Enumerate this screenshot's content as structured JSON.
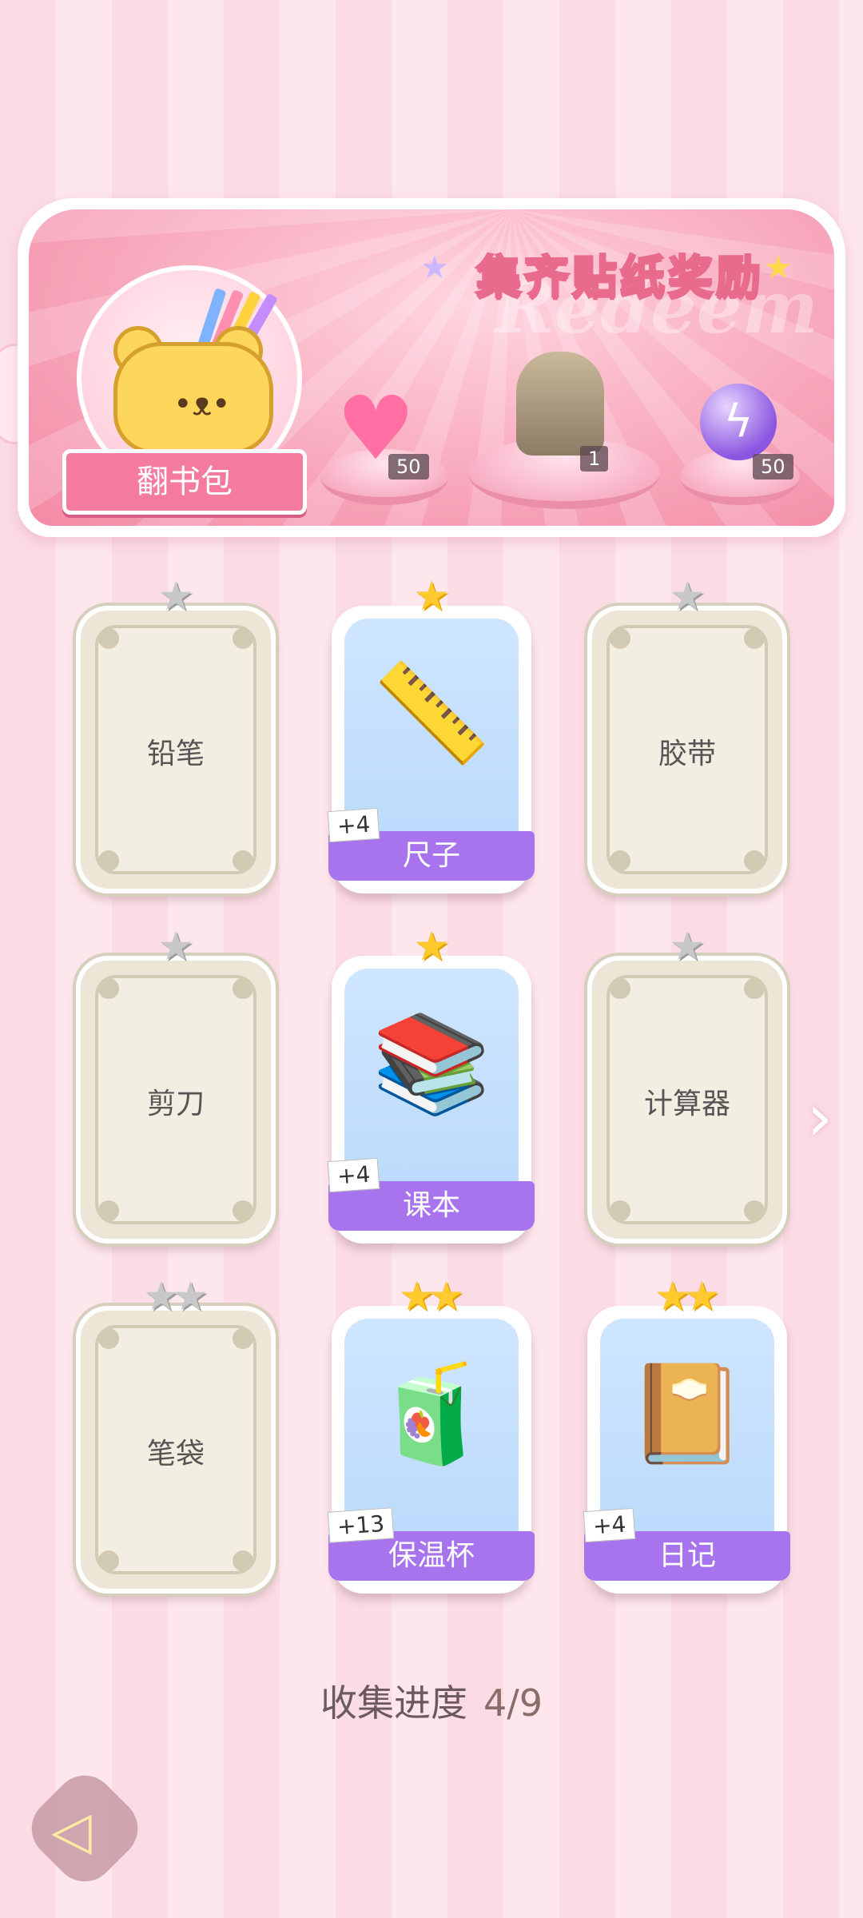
{
  "banner": {
    "title": "集齐贴纸奖励",
    "watermark": "Redeem",
    "bag_button": "翻书包",
    "rewards": [
      {
        "icon": "pink-heart-gem-icon",
        "count": "50"
      },
      {
        "icon": "outfit-portrait-icon",
        "count": "1"
      },
      {
        "icon": "purple-energy-orb-icon",
        "count": "50"
      }
    ]
  },
  "cards": [
    {
      "name": "铅笔",
      "state": "locked",
      "stars": 1,
      "stars_earned": 0
    },
    {
      "name": "尺子",
      "state": "unlocked",
      "stars": 1,
      "stars_earned": 1,
      "bonus": "+4",
      "art": "ruler-icon"
    },
    {
      "name": "胶带",
      "state": "locked",
      "stars": 1,
      "stars_earned": 0
    },
    {
      "name": "剪刀",
      "state": "locked",
      "stars": 1,
      "stars_earned": 0
    },
    {
      "name": "课本",
      "state": "unlocked",
      "stars": 1,
      "stars_earned": 1,
      "bonus": "+4",
      "art": "books-icon"
    },
    {
      "name": "计算器",
      "state": "locked",
      "stars": 1,
      "stars_earned": 0
    },
    {
      "name": "笔袋",
      "state": "locked",
      "stars": 2,
      "stars_earned": 0
    },
    {
      "name": "保温杯",
      "state": "unlocked",
      "stars": 2,
      "stars_earned": 2,
      "bonus": "+13",
      "art": "thermos-icon"
    },
    {
      "name": "日记",
      "state": "unlocked",
      "stars": 2,
      "stars_earned": 2,
      "bonus": "+4",
      "art": "diary-icon"
    }
  ],
  "progress": {
    "label": "收集进度",
    "value": "4/9"
  },
  "colors": {
    "accent": "#a774ee",
    "banner_pink": "#f47a9e",
    "gold": "#ffca2e"
  }
}
